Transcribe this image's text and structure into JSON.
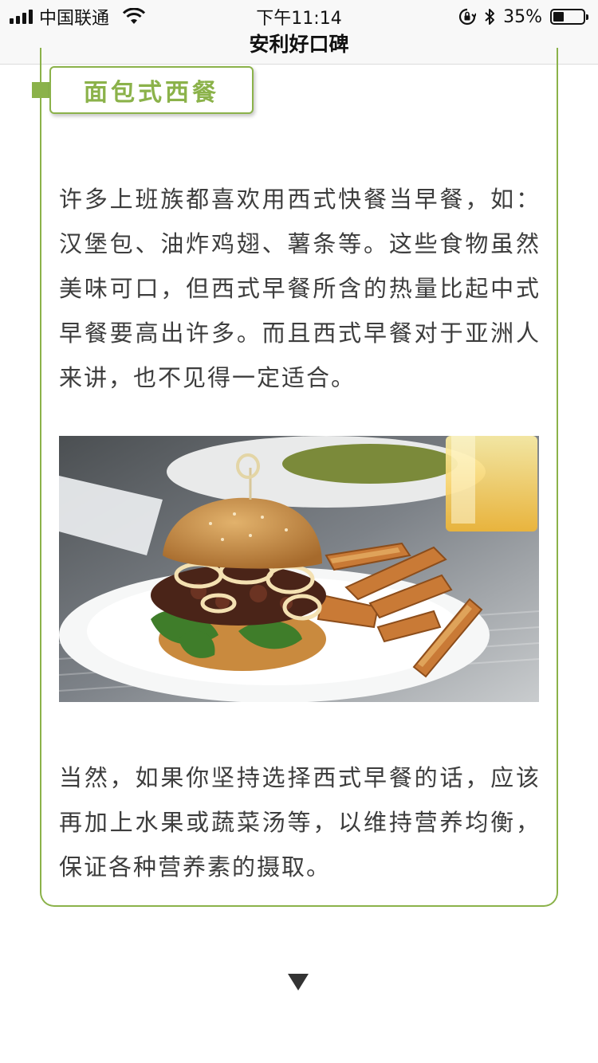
{
  "status_bar": {
    "carrier": "中国联通",
    "time": "下午11:14",
    "battery_text": "35%",
    "battery_level": 0.35,
    "icons": [
      "signal-icon",
      "wifi-icon",
      "orientation-lock-icon",
      "bluetooth-icon",
      "battery-icon"
    ]
  },
  "nav": {
    "title": "安利好口碑"
  },
  "section": {
    "tag": "面包式西餐",
    "paragraph1": "许多上班族都喜欢用西式快餐当早餐，如：汉堡包、油炸鸡翅、薯条等。这些食物虽然美味可口，但西式早餐所含的热量比起中式早餐要高出许多。而且西式早餐对于亚洲人来讲，也不见得一定适合。",
    "paragraph2": "当然，如果你坚持选择西式早餐的话，应该再加上水果或蔬菜汤等，以维持营养均衡，保证各种营养素的摄取。"
  },
  "footer": {
    "icon": "down-triangle-icon"
  },
  "colors": {
    "accent": "#8bb24a",
    "text": "#3d3d3d",
    "bar_bg": "#f8f8f8"
  }
}
